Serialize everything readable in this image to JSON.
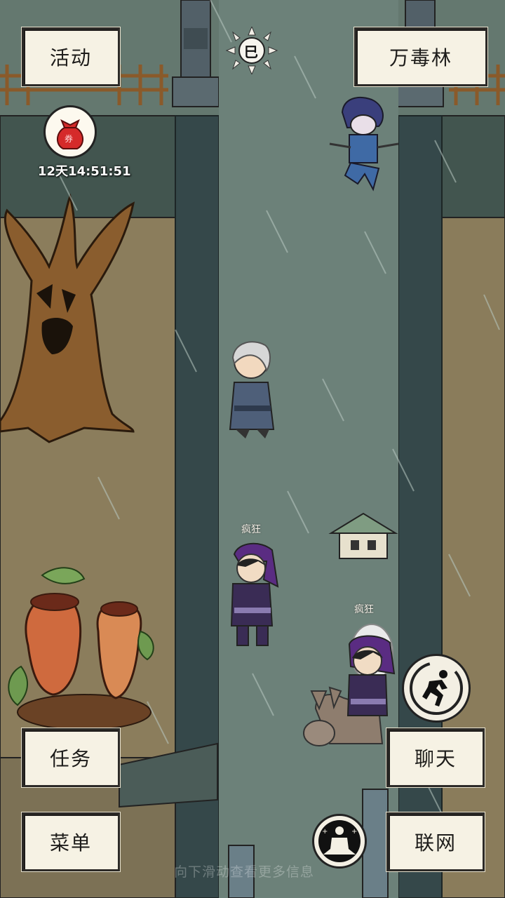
{
  "top_left_button": {
    "label": "活动"
  },
  "location_button": {
    "label": "万毒林"
  },
  "time_icon": {
    "glyph": "巳"
  },
  "event_bag": {
    "timer": "12天14:51:51"
  },
  "npc_labels": {
    "player_name": "疯狂",
    "rider_name": "疯狂"
  },
  "bottom_left": {
    "task_label": "任务",
    "menu_label": "菜单"
  },
  "bottom_right": {
    "chat_label": "聊天",
    "network_label": "联网"
  },
  "swipe_hint": "向下滑动查看更多信息",
  "icons": {
    "run": "run-icon",
    "meditate": "meditate-icon",
    "bag": "red-bag-icon",
    "sun": "sun-time-icon"
  }
}
